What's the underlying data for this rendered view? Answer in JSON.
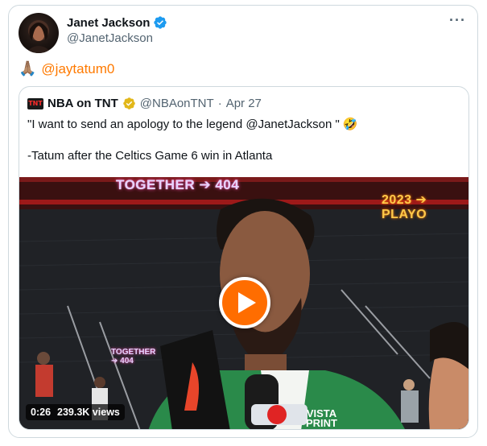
{
  "author": {
    "name": "Janet Jackson",
    "handle": "@JanetJackson",
    "verified_color": "#1d9bf0",
    "avatar_icon": "avatar-photo"
  },
  "tweet": {
    "emoji": "🙏🏽",
    "mention": "@jaytatum0",
    "mention_color": "#ff7a00"
  },
  "more_icon": "···",
  "quote": {
    "account_name": "NBA on TNT",
    "account_handle": "@NBAonTNT",
    "separator": "·",
    "date": "Apr 27",
    "badge_color": "#e2b719",
    "line1": "\"I want to send an apology to the legend @JanetJackson \"",
    "line1_emoji": "🤣",
    "line2": "-Tatum after the Celtics Game 6 win in Atlanta",
    "logo_text": "TNT"
  },
  "video": {
    "banner_text": "TOGETHER ➔ 404",
    "banner_right": "2023 ➔ PLAYO",
    "mini_banner_line1": "TOGETHER",
    "mini_banner_line2": "➔ 404",
    "jersey_line1": "VISTA",
    "jersey_line2": "PRINT",
    "duration": "0:26",
    "views": "239.3K views",
    "play_color": "#ff6d00"
  }
}
